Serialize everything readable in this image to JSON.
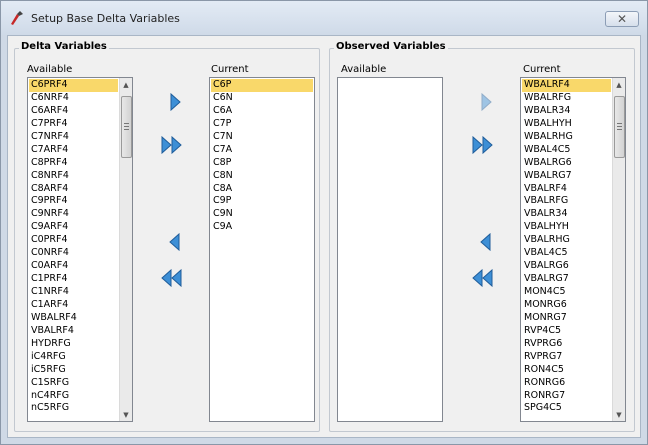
{
  "window": {
    "title": "Setup Base Delta Variables",
    "close_glyph": "✕"
  },
  "delta": {
    "legend": "Delta Variables",
    "available_label": "Available",
    "current_label": "Current",
    "available_items": [
      "C6PRF4",
      "C6NRF4",
      "C6ARF4",
      "C7PRF4",
      "C7NRF4",
      "C7ARF4",
      "C8PRF4",
      "C8NRF4",
      "C8ARF4",
      "C9PRF4",
      "C9NRF4",
      "C9ARF4",
      "C0PRF4",
      "C0NRF4",
      "C0ARF4",
      "C1PRF4",
      "C1NRF4",
      "C1ARF4",
      "WBALRF4",
      "VBALRF4",
      "HYDRFG",
      "iC4RFG",
      "iC5RFG",
      "C1SRFG",
      "nC4RFG",
      "nC5RFG"
    ],
    "current_items": [
      "C6P",
      "C6N",
      "C6A",
      "C7P",
      "C7N",
      "C7A",
      "C8P",
      "C8N",
      "C8A",
      "C9P",
      "C9N",
      "C9A"
    ]
  },
  "observed": {
    "legend": "Observed Variables",
    "available_label": "Available",
    "current_label": "Current",
    "available_items": [],
    "current_items": [
      "WBALRF4",
      "WBALRFG",
      "WBALR34",
      "WBALHYH",
      "WBALRHG",
      "WBAL4C5",
      "WBALRG6",
      "WBALRG7",
      "VBALRF4",
      "VBALRFG",
      "VBALR34",
      "VBALHYH",
      "VBALRHG",
      "VBAL4C5",
      "VBALRG6",
      "VBALRG7",
      "MON4C5",
      "MONRG6",
      "MONRG7",
      "RVP4C5",
      "RVPRG6",
      "RVPRG7",
      "RON4C5",
      "RONRG6",
      "RONRG7",
      "SPG4C5"
    ]
  },
  "icons": {
    "app": "app-tool-icon",
    "move_right": "arrow-right-icon",
    "move_all_right": "double-arrow-right-icon",
    "move_left": "arrow-left-icon",
    "move_all_left": "double-arrow-left-icon"
  },
  "colors": {
    "selection": "#f9d86a",
    "arrow": "#3d8fd6",
    "group_border": "#c2c8d0"
  }
}
